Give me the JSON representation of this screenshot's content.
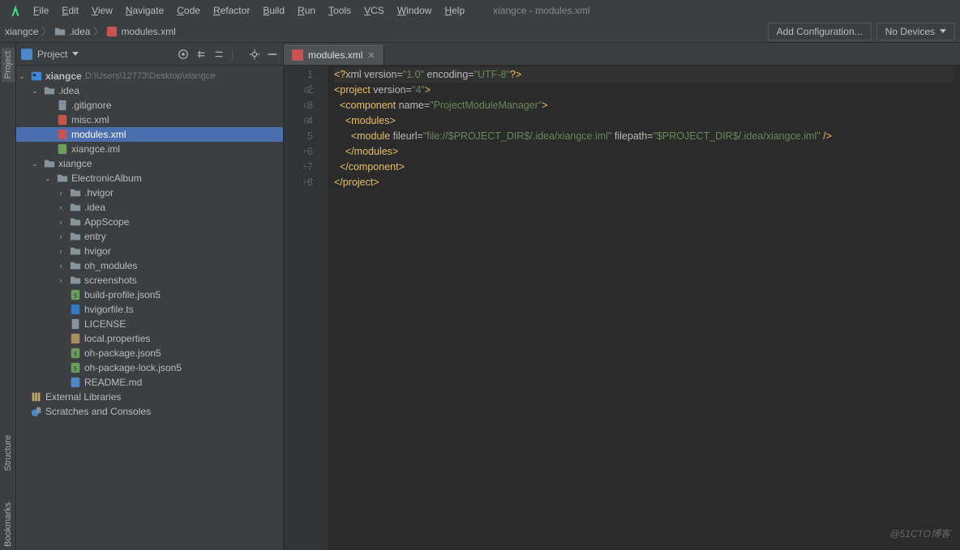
{
  "title": "xiangce - modules.xml",
  "menu": [
    "File",
    "Edit",
    "View",
    "Navigate",
    "Code",
    "Refactor",
    "Build",
    "Run",
    "Tools",
    "VCS",
    "Window",
    "Help"
  ],
  "breadcrumb": {
    "root": "xiangce",
    "mid": ".idea",
    "file": "modules.xml"
  },
  "nav_buttons": {
    "add_config": "Add Configuration...",
    "devices": "No Devices"
  },
  "side_tabs": [
    "Project",
    "Structure",
    "Bookmarks"
  ],
  "panel": {
    "title": "Project"
  },
  "tree": {
    "root": {
      "label": "xiangce",
      "path": "D:\\Users\\12773\\Desktop\\xiangce"
    },
    "idea": {
      "label": ".idea"
    },
    "idea_children": [
      {
        "label": ".gitignore",
        "kind": "gitignore"
      },
      {
        "label": "misc.xml",
        "kind": "xml"
      },
      {
        "label": "modules.xml",
        "kind": "xml",
        "selected": true
      },
      {
        "label": "xiangce.iml",
        "kind": "iml"
      }
    ],
    "xiangce2": {
      "label": "xiangce"
    },
    "ea": {
      "label": "ElectronicAlbum"
    },
    "ea_folders": [
      ".hvigor",
      ".idea",
      "AppScope",
      "entry",
      "hvigor",
      "oh_modules",
      "screenshots"
    ],
    "ea_files": [
      {
        "label": "build-profile.json5",
        "kind": "json5"
      },
      {
        "label": "hvigorfile.ts",
        "kind": "ts"
      },
      {
        "label": "LICENSE",
        "kind": "text"
      },
      {
        "label": "local.properties",
        "kind": "props"
      },
      {
        "label": "oh-package.json5",
        "kind": "json5"
      },
      {
        "label": "oh-package-lock.json5",
        "kind": "json5"
      },
      {
        "label": "README.md",
        "kind": "md"
      }
    ],
    "ext_lib": "External Libraries",
    "scratches": "Scratches and Consoles"
  },
  "editor": {
    "tab_label": "modules.xml",
    "lines": [
      {
        "n": 1,
        "seg": [
          {
            "t": "<?",
            "c": "tag"
          },
          {
            "t": "xml version",
            "c": "attr"
          },
          {
            "t": "=",
            "c": "attr"
          },
          {
            "t": "\"1.0\"",
            "c": "str"
          },
          {
            "t": " encoding",
            "c": "attr"
          },
          {
            "t": "=",
            "c": "attr"
          },
          {
            "t": "\"UTF-8\"",
            "c": "str"
          },
          {
            "t": "?>",
            "c": "tag"
          }
        ]
      },
      {
        "n": 2,
        "fold": "-",
        "seg": [
          {
            "t": "<project ",
            "c": "tag"
          },
          {
            "t": "version",
            "c": "attr"
          },
          {
            "t": "=",
            "c": "attr"
          },
          {
            "t": "\"4\"",
            "c": "str"
          },
          {
            "t": ">",
            "c": "tag"
          }
        ]
      },
      {
        "n": 3,
        "fold": "-",
        "indent": "  ",
        "seg": [
          {
            "t": "<component ",
            "c": "tag"
          },
          {
            "t": "name",
            "c": "attr"
          },
          {
            "t": "=",
            "c": "attr"
          },
          {
            "t": "\"ProjectModuleManager\"",
            "c": "str"
          },
          {
            "t": ">",
            "c": "tag"
          }
        ]
      },
      {
        "n": 4,
        "fold": "-",
        "indent": "    ",
        "seg": [
          {
            "t": "<modules>",
            "c": "tag"
          }
        ]
      },
      {
        "n": 5,
        "indent": "      ",
        "seg": [
          {
            "t": "<module ",
            "c": "tag"
          },
          {
            "t": "fileurl",
            "c": "attr"
          },
          {
            "t": "=",
            "c": "attr"
          },
          {
            "t": "\"file://$PROJECT_DIR$/.idea/xiangce.iml\"",
            "c": "str"
          },
          {
            "t": " filepath",
            "c": "attr"
          },
          {
            "t": "=",
            "c": "attr"
          },
          {
            "t": "\"$PROJECT_DIR$/.idea/xiangce.iml\"",
            "c": "str"
          },
          {
            "t": " />",
            "c": "tag"
          }
        ]
      },
      {
        "n": 6,
        "fold": "^",
        "indent": "    ",
        "seg": [
          {
            "t": "</modules>",
            "c": "tag"
          }
        ]
      },
      {
        "n": 7,
        "fold": "^",
        "indent": "  ",
        "seg": [
          {
            "t": "</component>",
            "c": "tag"
          }
        ]
      },
      {
        "n": 8,
        "fold": "^",
        "seg": [
          {
            "t": "</project>",
            "c": "tag"
          }
        ]
      }
    ]
  },
  "watermark": "@51CTO博客"
}
